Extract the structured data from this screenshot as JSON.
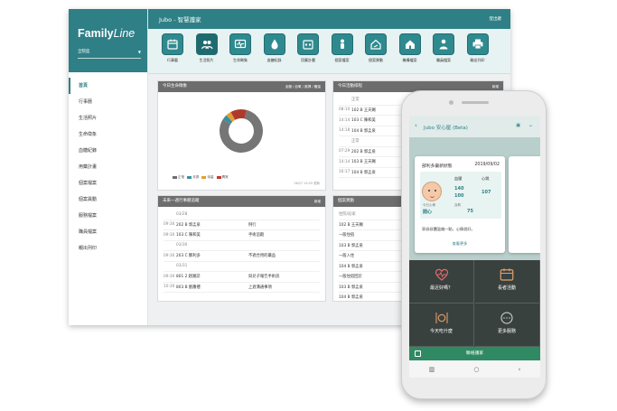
{
  "desktop": {
    "brand": {
      "name_a": "Family",
      "name_b": "Line",
      "select": "全院區"
    },
    "topbar": {
      "title": "Jubo - 智慧護家",
      "right": "登出鍵"
    },
    "sidebar": {
      "items": [
        {
          "label": "首頁",
          "active": true
        },
        {
          "label": "行事曆"
        },
        {
          "label": "生活照片"
        },
        {
          "label": "生命徵象"
        },
        {
          "label": "血糖紀錄"
        },
        {
          "label": "用藥計畫"
        },
        {
          "label": "個案檔案"
        },
        {
          "label": "個案異動"
        },
        {
          "label": "服務檔案"
        },
        {
          "label": "職員檔案"
        },
        {
          "label": "親出列印"
        }
      ]
    },
    "toolbar": {
      "items": [
        {
          "label": "行事曆",
          "icon": "calendar-icon"
        },
        {
          "label": "生活照片",
          "icon": "photo-icon",
          "active": true
        },
        {
          "label": "生命徵象",
          "icon": "monitor-icon"
        },
        {
          "label": "血糖紀錄",
          "icon": "blood-drop-icon"
        },
        {
          "label": "用藥計畫",
          "icon": "medication-calendar-icon"
        },
        {
          "label": "個案檔案",
          "icon": "person-icon"
        },
        {
          "label": "個案異動",
          "icon": "house-change-icon"
        },
        {
          "label": "機構檔案",
          "icon": "building-icon"
        },
        {
          "label": "職員檔案",
          "icon": "staff-icon"
        },
        {
          "label": "輸出列印",
          "icon": "printer-icon"
        }
      ]
    },
    "cards": {
      "vitals": {
        "title": "今日生命徵象",
        "right": "血壓 / 血氧 / 脈搏 / 體溫",
        "legend": [
          {
            "label": "正常",
            "color": "#6e6e6e"
          },
          {
            "label": "未測",
            "color": "#3a8fa0"
          },
          {
            "label": "待量",
            "color": "#e0a030"
          },
          {
            "label": "異常",
            "color": "#c0392b"
          }
        ],
        "footer": "06/27 14:55 更新",
        "chart_data": {
          "type": "pie",
          "donut": true,
          "slices": [
            {
              "label": "正常",
              "value": 80,
              "color": "#767676"
            },
            {
              "label": "未測",
              "value": 4,
              "color": "#3a8fa0"
            },
            {
              "label": "待量",
              "value": 4,
              "color": "#e0a030"
            },
            {
              "label": "異常",
              "value": 12,
              "color": "#b0392b"
            }
          ]
        }
      },
      "activity": {
        "title": "今日活動排程",
        "right": "新增",
        "rows": [
          {
            "time": "",
            "room": "正常",
            "date": true
          },
          {
            "time": "08:10",
            "room": "102 B 王天賜"
          },
          {
            "time": "14:14",
            "room": "103 C 陳和美"
          },
          {
            "time": "14:18",
            "room": "104 B 郭孟泉"
          },
          {
            "time": "",
            "room": "正常",
            "date": true
          },
          {
            "time": "07:29",
            "room": "202 B 郭孟泉"
          },
          {
            "time": "14:14",
            "room": "103 B 王天賜"
          },
          {
            "time": "16:17",
            "room": "104 B 郭孟泉"
          }
        ]
      },
      "appointments": {
        "title": "未來一週行事曆追蹤",
        "right": "新增",
        "rows": [
          {
            "time": "",
            "name": "03/28",
            "note": "",
            "date": true
          },
          {
            "time": "09:30",
            "name": "202 B 郭孟泉",
            "note": "例行"
          },
          {
            "time": "09:30",
            "name": "103 C 陳和美",
            "note": "手術追蹤"
          },
          {
            "time": "",
            "name": "03/30",
            "note": "",
            "date": true
          },
          {
            "time": "09:30",
            "name": "203 C 鄭利多",
            "note": "不適合用的藥品"
          },
          {
            "time": "",
            "name": "03/31",
            "note": "",
            "date": true
          },
          {
            "time": "09:30",
            "name": "801 2 趙湘誌",
            "note": "與兒子報告手術訊"
          },
          {
            "time": "10:30",
            "name": "803 B 劉蕭禮",
            "note": "上週溝通事項"
          }
        ]
      },
      "case_changes": {
        "title": "個案異動",
        "rows": [
          {
            "text": "住院/返家",
            "date": true
          },
          {
            "text": "102 B 王天賜"
          },
          {
            "text": "一般住宿"
          },
          {
            "text": "103 B 郭孟泉"
          },
          {
            "text": "一般入住"
          },
          {
            "text": "104 B 郭孟泉"
          },
          {
            "text": "一般住宿回診"
          },
          {
            "text": "103 B 郭孟泉"
          },
          {
            "text": "104 B 郭孟泉"
          }
        ]
      }
    }
  },
  "phone": {
    "header": {
      "title": "Jubo 安心屋 (Beta)",
      "back": "‹",
      "chev": "⌄"
    },
    "card": {
      "title": "部利多最新狀態",
      "date": "2019/09/02",
      "bp_label": "血壓",
      "hr_label": "心跳",
      "bp_value": "140",
      "bp_value2": "100",
      "hr_value": "107",
      "sub_label_a": "今日心情",
      "sub_value_a": "開心",
      "sub_label_b": "血氧",
      "sub_value_b": "75",
      "message": "郭叔叔體溫偏一點，心情很好。",
      "more": "查看更多"
    },
    "grid": [
      {
        "label": "最近好嗎？",
        "icon": "heart-pulse-icon"
      },
      {
        "label": "長者活動",
        "icon": "calendar-icon"
      },
      {
        "label": "今天吃什麼",
        "icon": "meal-icon"
      },
      {
        "label": "更多服務",
        "icon": "more-services-icon"
      }
    ],
    "bottom": {
      "label": "聯絡護家"
    }
  }
}
